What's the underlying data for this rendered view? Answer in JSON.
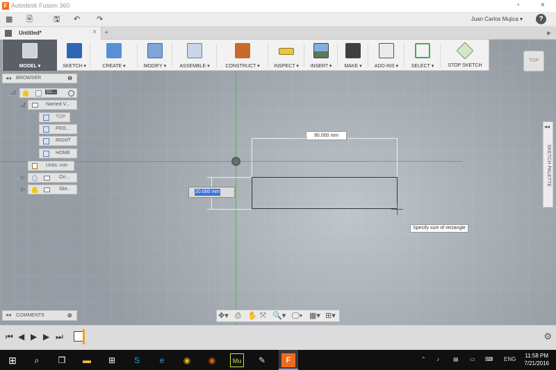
{
  "titlebar": {
    "title": "Autodesk Fusion 360",
    "logo": "F",
    "restore": "▫",
    "close": "×"
  },
  "appbar": {
    "grid_icon": "▦",
    "file_icon": "🗎",
    "save_icon": "🖫",
    "undo_icon": "↶",
    "redo_icon": "↷",
    "user": "Juan Carlos Mujica ▾",
    "help": "?"
  },
  "doc_tab": {
    "name": "Untitled*",
    "close": "×",
    "new_tab": "+",
    "more": "▸"
  },
  "toolbar": {
    "model": "MODEL ▾",
    "sketch": "SKETCH ▾",
    "create": "CREATE ▾",
    "modify": "MODIFY ▾",
    "assemble": "ASSEMBLE ▾",
    "construct": "CONSTRUCT ▾",
    "inspect": "INSPECT ▾",
    "insert": "INSERT ▾",
    "make": "MAKE ▾",
    "addins": "ADD-INS ▾",
    "select": "SELECT ▾",
    "stop_sketch": "STOP SKETCH",
    "colors": {
      "sketch_icon": "#2e66b5",
      "create_icon": "#5a8fd6",
      "construct_icon": "#c86a2a",
      "make_icon": "#3f3f3f"
    }
  },
  "viewcube": {
    "label": "TOP"
  },
  "browser": {
    "title": "BROWSER",
    "root_label": "(U...",
    "named_views": "Named V...",
    "views": [
      "TOP",
      "FRO...",
      "RIGHT",
      "HOME"
    ],
    "units": "Units: mm",
    "origin": "Ori...",
    "sketches": "Ske..."
  },
  "sketch": {
    "dim_width": "90.000 mm",
    "dim_height": "20.000 mm",
    "tooltip": "Specify size of rectangle"
  },
  "sketch_palette": {
    "label": "SKETCH PALETTE",
    "collapse": "◂◂"
  },
  "comments": {
    "title": "COMMENTS"
  },
  "navbar": [
    "✥▾",
    "⎙",
    "✋",
    "⤧",
    "🔍▾",
    "🖵▾",
    "▦▾",
    "⊞▾"
  ],
  "timeline": {
    "controls": [
      "⏮",
      "◀",
      "▶",
      "▶",
      "⏭"
    ]
  },
  "taskbar": {
    "clock_time": "11:58 PM",
    "clock_date": "7/21/2016",
    "lang": "ENG"
  }
}
